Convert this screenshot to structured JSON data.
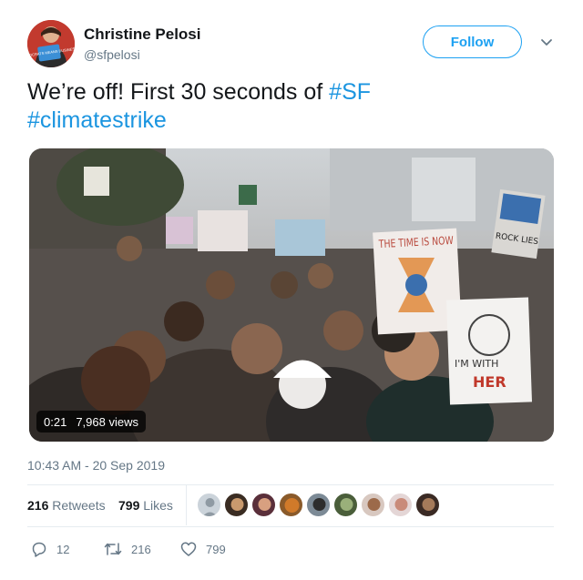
{
  "author": {
    "name": "Christine Pelosi",
    "handle": "@sfpelosi",
    "avatar_badge_text": "DEMOCRATS MEANS BUSINESS"
  },
  "follow_button": {
    "label": "Follow"
  },
  "tweet": {
    "text_plain": "We’re off! First 30 seconds of ",
    "hashtag_1": "#SF",
    "hashtag_2": "#climatestrike"
  },
  "media": {
    "type": "video",
    "duration": "0:21",
    "views": "7,968 views",
    "signs": {
      "sign_1": "THE TIME IS NOW",
      "sign_2_line_1": "I'M WITH",
      "sign_2_line_2": "HER",
      "sign_3": "ROCK LIES"
    }
  },
  "timestamp": "10:43 AM - 20 Sep 2019",
  "stats": {
    "retweets_count": "216",
    "retweets_label": "Retweets",
    "likes_count": "799",
    "likes_label": "Likes"
  },
  "actions": {
    "replies": "12",
    "retweets": "216",
    "likes": "799"
  },
  "colors": {
    "accent": "#1da1f2",
    "link": "#1b95e0",
    "secondary_text": "#657786",
    "divider": "#e6ecf0"
  },
  "icons": {
    "chevron": "chevron-down-icon",
    "reply": "reply-icon",
    "retweet": "retweet-icon",
    "like": "heart-icon"
  }
}
